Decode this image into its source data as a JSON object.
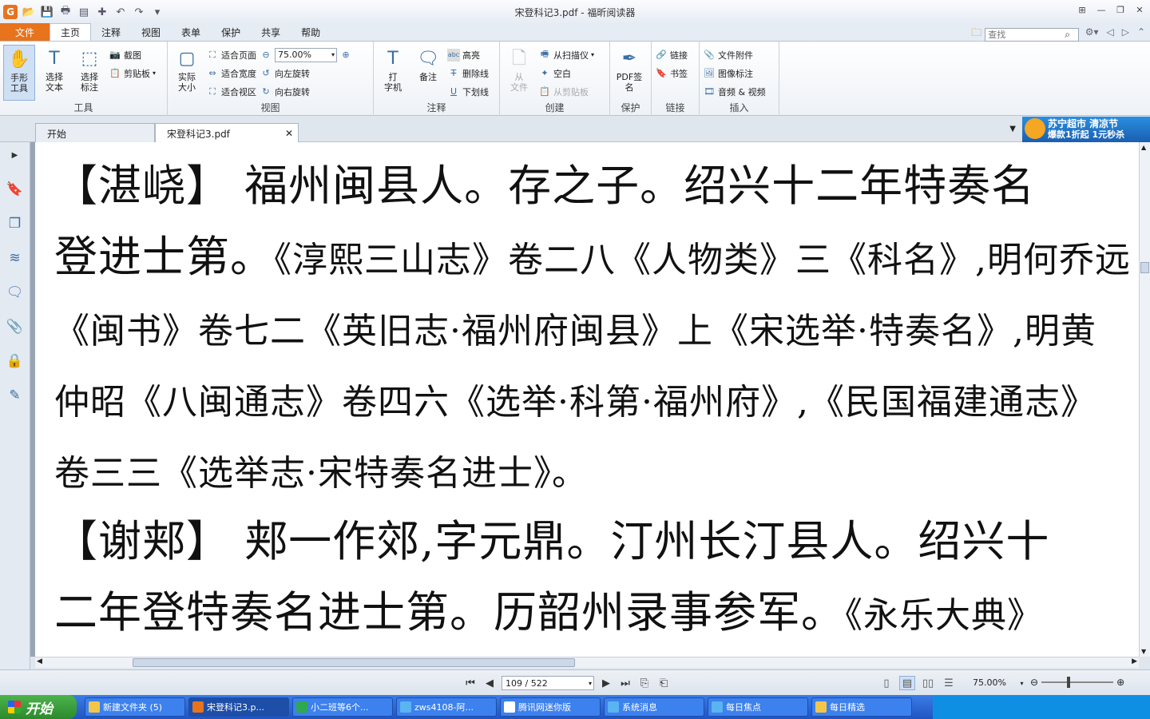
{
  "window": {
    "title": "宋登科记3.pdf - 福昕阅读器"
  },
  "menu": {
    "file": "文件",
    "tabs": [
      "主页",
      "注释",
      "视图",
      "表单",
      "保护",
      "共享",
      "帮助"
    ],
    "active_tab": "主页",
    "search_placeholder": "查找"
  },
  "ribbon": {
    "tools": {
      "label": "工具",
      "hand": "手形\n工具",
      "select_text": "选择\n文本",
      "select_annot": "选择\n标注",
      "snapshot": "截图",
      "clipboard": "剪贴板"
    },
    "view": {
      "label": "视图",
      "actual_size": "实际\n大小",
      "fit_page": "适合页面",
      "fit_width": "适合宽度",
      "fit_visible": "适合视区",
      "zoom_value": "75.00%",
      "rotate_left": "向左旋转",
      "rotate_right": "向右旋转"
    },
    "annot": {
      "label": "注释",
      "typewriter": "打\n字机",
      "note": "备注",
      "highlight": "高亮",
      "strikeout": "删除线",
      "underline": "下划线"
    },
    "create": {
      "label": "创建",
      "from_file": "从\n文件",
      "from_scanner": "从扫描仪",
      "blank": "空白",
      "from_clipboard": "从剪贴板"
    },
    "protect": {
      "label": "保护",
      "pdf_sign": "PDF签\n名"
    },
    "links": {
      "label": "链接",
      "link": "链接",
      "bookmark": "书签"
    },
    "insert": {
      "label": "插入",
      "file_attach": "文件附件",
      "image_annot": "图像标注",
      "audio_video": "音频 & 视频"
    }
  },
  "doc_tabs": [
    {
      "label": "开始"
    },
    {
      "label": "宋登科记3.pdf"
    }
  ],
  "ad": {
    "line1": "苏宁超市 清凉节",
    "line2": "爆款1折起 1元秒杀"
  },
  "document": {
    "lines": [
      [
        "【湛峣】 福州闽县人。存之子。绍兴十二年特奏名",
        ""
      ],
      [
        "登进士第。",
        "《淳熙三山志》卷二八《人物类》三《科名》,明何乔远"
      ],
      [
        "",
        "《闽书》卷七二《英旧志·福州府闽县》上《宋选举·特奏名》,明黄"
      ],
      [
        "",
        "仲昭《八闽通志》卷四六《选举·科第·福州府》,《民国福建通志》"
      ],
      [
        "",
        "卷三三《选举志·宋特奏名进士》。"
      ],
      [
        "【谢郏】 郏一作郊,字元鼎。汀州长汀县人。绍兴十",
        ""
      ],
      [
        "二年登特奏名进士第。历韶州录事参军。",
        "《永乐大典》"
      ]
    ]
  },
  "status": {
    "page": "109 / 522",
    "zoom": "75.00%"
  },
  "taskbar": {
    "start": "开始",
    "tasks": [
      "新建文件夹 (5)",
      "宋登科记3.p...",
      "小二班等6个...",
      "zws4108-阿...",
      "腾讯网迷你版",
      "系统消息",
      "每日焦点",
      "每日精选"
    ]
  },
  "colors": {
    "accent": "#e8731d",
    "ribbon_blue": "#3a6ea5",
    "taskbar": "#1f55c4"
  }
}
